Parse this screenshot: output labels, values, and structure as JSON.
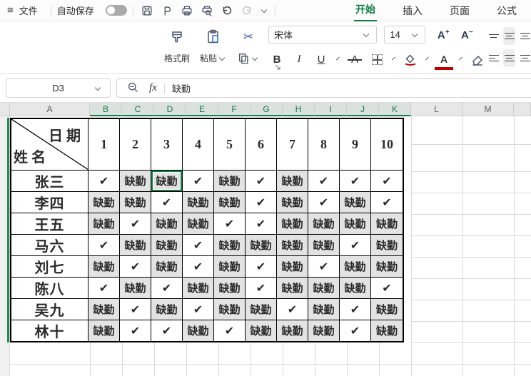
{
  "menubar": {
    "menu_icon": "≡",
    "file": "文件",
    "autosave": "自动保存",
    "autosave_state": "off",
    "icons": [
      "save-icon",
      "export-icon",
      "print-icon",
      "print-preview-icon",
      "undo-icon",
      "redo-icon",
      "more-dropdown-icon"
    ],
    "tabs": [
      {
        "label": "开始",
        "active": true
      },
      {
        "label": "插入",
        "active": false
      },
      {
        "label": "页面",
        "active": false
      },
      {
        "label": "公式",
        "active": false
      }
    ]
  },
  "toolbar": {
    "format_painter": "格式刷",
    "paste": "粘贴",
    "font_name": "宋体",
    "font_size": "14",
    "bold": "B",
    "italic": "I",
    "underline": "U",
    "strikethrough": "A",
    "font_grow": "A",
    "font_grow_sup": "+",
    "font_shrink": "A",
    "font_shrink_sup": "−"
  },
  "formula_bar": {
    "cell_ref": "D3",
    "fx_label": "fx",
    "value": "缺勤"
  },
  "sheet": {
    "col_headers": [
      {
        "label": "A",
        "selected": false
      },
      {
        "label": "B",
        "selected": true
      },
      {
        "label": "C",
        "selected": true
      },
      {
        "label": "D",
        "selected": true
      },
      {
        "label": "E",
        "selected": true
      },
      {
        "label": "F",
        "selected": true
      },
      {
        "label": "G",
        "selected": true
      },
      {
        "label": "H",
        "selected": true
      },
      {
        "label": "I",
        "selected": true
      },
      {
        "label": "J",
        "selected": true
      },
      {
        "label": "K",
        "selected": true
      },
      {
        "label": "L",
        "selected": false
      },
      {
        "label": "M",
        "selected": false
      }
    ],
    "corner_top_right": "日期",
    "corner_bottom_left": "姓名",
    "days": [
      "1",
      "2",
      "3",
      "4",
      "5",
      "6",
      "7",
      "8",
      "9",
      "10"
    ],
    "check_glyph": "✔",
    "absent_label": "缺勤",
    "rows": [
      {
        "name": "张三",
        "cells": [
          "check",
          "absent",
          "absent",
          "check",
          "absent",
          "check",
          "absent",
          "check",
          "check",
          "check"
        ]
      },
      {
        "name": "李四",
        "cells": [
          "absent",
          "absent",
          "check",
          "absent",
          "absent",
          "check",
          "absent",
          "check",
          "absent",
          "check"
        ]
      },
      {
        "name": "王五",
        "cells": [
          "absent",
          "check",
          "absent",
          "absent",
          "check",
          "check",
          "absent",
          "absent",
          "absent",
          "absent"
        ]
      },
      {
        "name": "马六",
        "cells": [
          "check",
          "absent",
          "absent",
          "check",
          "absent",
          "absent",
          "absent",
          "absent",
          "check",
          "absent"
        ]
      },
      {
        "name": "刘七",
        "cells": [
          "absent",
          "check",
          "absent",
          "check",
          "absent",
          "check",
          "absent",
          "check",
          "absent",
          "absent"
        ]
      },
      {
        "name": "陈八",
        "cells": [
          "check",
          "absent",
          "check",
          "absent",
          "absent",
          "check",
          "absent",
          "absent",
          "absent",
          "check"
        ]
      },
      {
        "name": "吴九",
        "cells": [
          "absent",
          "check",
          "absent",
          "check",
          "absent",
          "absent",
          "check",
          "absent",
          "check",
          "absent"
        ]
      },
      {
        "name": "林十",
        "cells": [
          "absent",
          "check",
          "check",
          "absent",
          "check",
          "absent",
          "absent",
          "absent",
          "check",
          "absent"
        ]
      }
    ],
    "selected_cell": {
      "ref": "D3",
      "row_index": 0,
      "day_index": 2
    }
  },
  "colors": {
    "accent_green": "#107C41",
    "absent_bg": "#e3e3e3",
    "gridline": "#d9d9d9",
    "font_color_red": "#c00000"
  }
}
